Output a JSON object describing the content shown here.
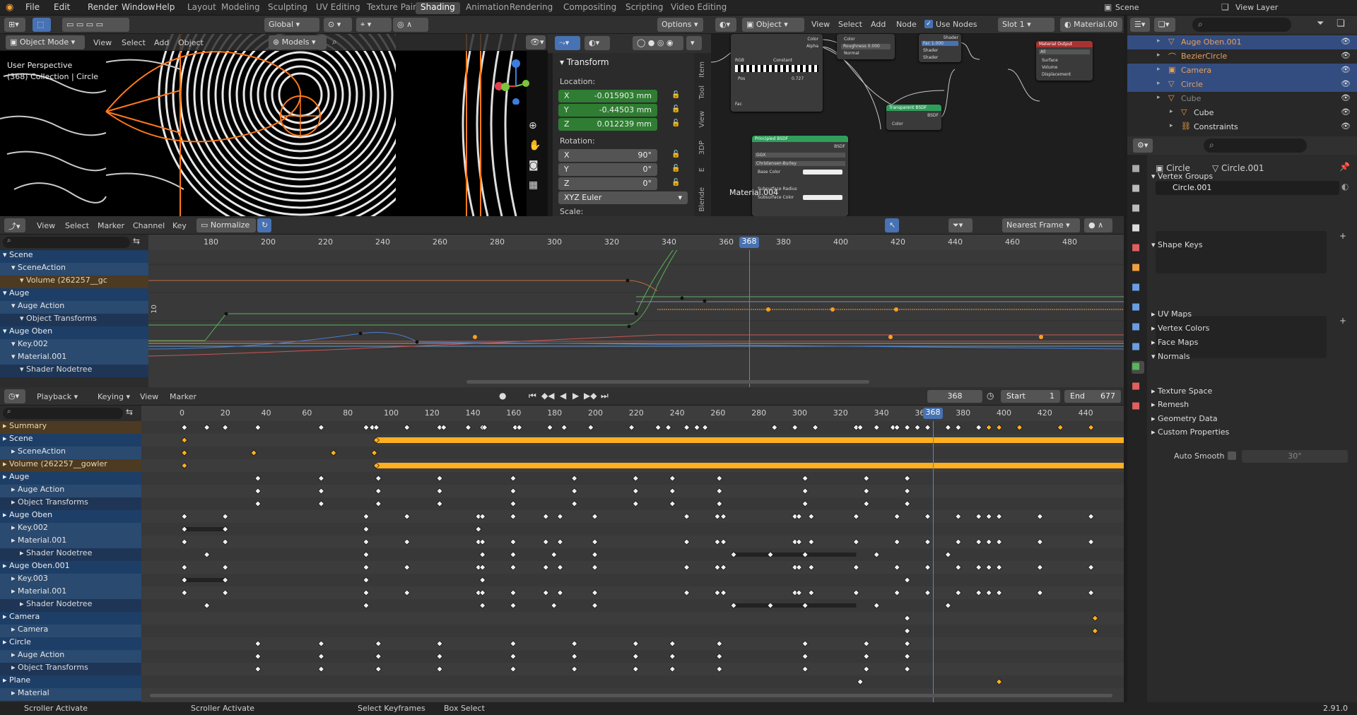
{
  "topbar": {
    "menus": [
      "File",
      "Edit",
      "Render",
      "Window",
      "Help"
    ],
    "workspaces": [
      "Layout",
      "Modeling",
      "Sculpting",
      "UV Editing",
      "Texture Paint",
      "Shading",
      "Animation",
      "Rendering",
      "Compositing",
      "Scripting",
      "Video Editing"
    ],
    "active_workspace": "Shading",
    "scene": "Scene",
    "view_layer": "View Layer"
  },
  "viewport": {
    "mode": "Object Mode",
    "menus": [
      "View",
      "Select",
      "Add",
      "Object"
    ],
    "orientation": "Global",
    "collection_dropdown": "Models",
    "options": "Options",
    "overlay_title": "User Perspective",
    "overlay_sub": "(368) Collection | Circle"
  },
  "transform": {
    "title": "Transform",
    "location_label": "Location:",
    "loc": [
      {
        "axis": "X",
        "value": "-0.015903 mm"
      },
      {
        "axis": "Y",
        "value": "-0.44503 mm"
      },
      {
        "axis": "Z",
        "value": "0.012239 mm"
      }
    ],
    "rotation_label": "Rotation:",
    "rot": [
      {
        "axis": "X",
        "value": "90°"
      },
      {
        "axis": "Y",
        "value": "0°"
      },
      {
        "axis": "Z",
        "value": "0°"
      }
    ],
    "rot_mode": "XYZ Euler",
    "scale_label": "Scale:",
    "side_tabs": [
      "Item",
      "Tool",
      "View",
      "3DP",
      "E",
      "Blende"
    ]
  },
  "node_editor": {
    "object_dropdown": "Object",
    "menus": [
      "View",
      "Select",
      "Add",
      "Node"
    ],
    "use_nodes": "Use Nodes",
    "slot": "Slot 1",
    "material": "Material.00",
    "mat_label": "Material.004",
    "nodes": {
      "principled": "Principled BSDF",
      "transparent": "Transparent BSDF",
      "output": "Material Output",
      "mix": "Shader",
      "roughness": "Roughness",
      "roughness_val": "0.000",
      "fac": "Fac",
      "fac_val": "1.000",
      "color": "Color",
      "alpha": "Alpha",
      "all": "All",
      "surface": "Surface",
      "volume": "Volume",
      "displacement": "Displacement",
      "rgb": "RGB",
      "constant": "Constant",
      "pos": "Pos",
      "pos_val": "0.727",
      "ggx": "GGX",
      "christensen": "Christensen-Burley",
      "base_color": "Base Color",
      "subsurface_radius": "Subsurface Radius",
      "subsurface_color": "Subsurface Color",
      "bsdf": "BSDF",
      "normal": "Normal"
    }
  },
  "outliner": {
    "items": [
      {
        "name": "Auge Oben.001",
        "color": "#e8a060",
        "hl": true
      },
      {
        "name": "BezierCircle",
        "color": "#e8a060",
        "hl": false
      },
      {
        "name": "Camera",
        "color": "#e8a060",
        "hl": true
      },
      {
        "name": "Circle",
        "color": "#e8a060",
        "hl": true
      },
      {
        "name": "Cube",
        "color": "#888",
        "hl": false
      },
      {
        "name": "Cube",
        "color": "#ddd",
        "hl": false
      },
      {
        "name": "Constraints",
        "color": "#ddd",
        "hl": false
      }
    ]
  },
  "properties": {
    "object": "Circle",
    "mesh": "Circle.001",
    "mesh_field": "Circle.001",
    "sections": [
      "Vertex Groups",
      "Shape Keys",
      "UV Maps",
      "Vertex Colors",
      "Face Maps",
      "Normals",
      "Texture Space",
      "Remesh",
      "Geometry Data",
      "Custom Properties"
    ],
    "auto_smooth": "Auto Smooth",
    "auto_smooth_angle": "30°"
  },
  "graph_editor": {
    "menus": [
      "View",
      "Select",
      "Marker",
      "Channel",
      "Key"
    ],
    "normalize": "Normalize",
    "snap": "Nearest Frame",
    "ruler": [
      "180",
      "200",
      "220",
      "240",
      "260",
      "280",
      "300",
      "320",
      "340",
      "360",
      "380",
      "400",
      "420",
      "440",
      "460",
      "480"
    ],
    "current_frame": "368",
    "y_label": "10",
    "channels": [
      {
        "name": "Scene",
        "type": "obj",
        "indent": 0
      },
      {
        "name": "SceneAction",
        "type": "act",
        "indent": 1
      },
      {
        "name": "Volume (262257__gc",
        "type": "sum",
        "indent": 2
      },
      {
        "name": "Auge",
        "type": "obj",
        "indent": 0
      },
      {
        "name": "Auge Action",
        "type": "act",
        "indent": 1
      },
      {
        "name": "Object Transforms",
        "type": "sub",
        "indent": 2
      },
      {
        "name": "Auge Oben",
        "type": "obj",
        "indent": 0
      },
      {
        "name": "Key.002",
        "type": "act",
        "indent": 1
      },
      {
        "name": "Material.001",
        "type": "act",
        "indent": 1
      },
      {
        "name": "Shader Nodetree",
        "type": "sub",
        "indent": 2
      }
    ]
  },
  "dopesheet": {
    "menus": [
      "Playback",
      "Keying",
      "View",
      "Marker"
    ],
    "frame": "368",
    "start_label": "Start",
    "start": "1",
    "end_label": "End",
    "end": "677",
    "ruler": [
      "0",
      "20",
      "40",
      "60",
      "80",
      "100",
      "120",
      "140",
      "160",
      "180",
      "200",
      "220",
      "240",
      "260",
      "280",
      "300",
      "320",
      "340",
      "360",
      "380",
      "400",
      "420",
      "440"
    ],
    "channels": [
      {
        "name": "Summary",
        "type": "sum",
        "indent": 0
      },
      {
        "name": "Scene",
        "type": "obj",
        "indent": 0
      },
      {
        "name": "SceneAction",
        "type": "act",
        "indent": 1
      },
      {
        "name": "Volume (262257__gowler",
        "type": "sum",
        "indent": 0
      },
      {
        "name": "Auge",
        "type": "obj",
        "indent": 0
      },
      {
        "name": "Auge Action",
        "type": "act",
        "indent": 1
      },
      {
        "name": "Object Transforms",
        "type": "sub",
        "indent": 1
      },
      {
        "name": "Auge Oben",
        "type": "obj",
        "indent": 0
      },
      {
        "name": "Key.002",
        "type": "act",
        "indent": 1
      },
      {
        "name": "Material.001",
        "type": "act",
        "indent": 1
      },
      {
        "name": "Shader Nodetree",
        "type": "sub",
        "indent": 2
      },
      {
        "name": "Auge Oben.001",
        "type": "obj",
        "indent": 0
      },
      {
        "name": "Key.003",
        "type": "act",
        "indent": 1
      },
      {
        "name": "Material.001",
        "type": "act",
        "indent": 1
      },
      {
        "name": "Shader Nodetree",
        "type": "sub",
        "indent": 2
      },
      {
        "name": "Camera",
        "type": "obj",
        "indent": 0
      },
      {
        "name": "Camera",
        "type": "act",
        "indent": 1
      },
      {
        "name": "Circle",
        "type": "obj",
        "indent": 0
      },
      {
        "name": "Auge Action",
        "type": "act",
        "indent": 1
      },
      {
        "name": "Object Transforms",
        "type": "sub",
        "indent": 1
      },
      {
        "name": "Plane",
        "type": "obj",
        "indent": 0
      },
      {
        "name": "Material",
        "type": "act",
        "indent": 1
      }
    ]
  },
  "status": {
    "items": [
      "Scroller Activate",
      "Scroller Activate",
      "Select Keyframes",
      "Box Select"
    ],
    "version": "2.91.0"
  }
}
